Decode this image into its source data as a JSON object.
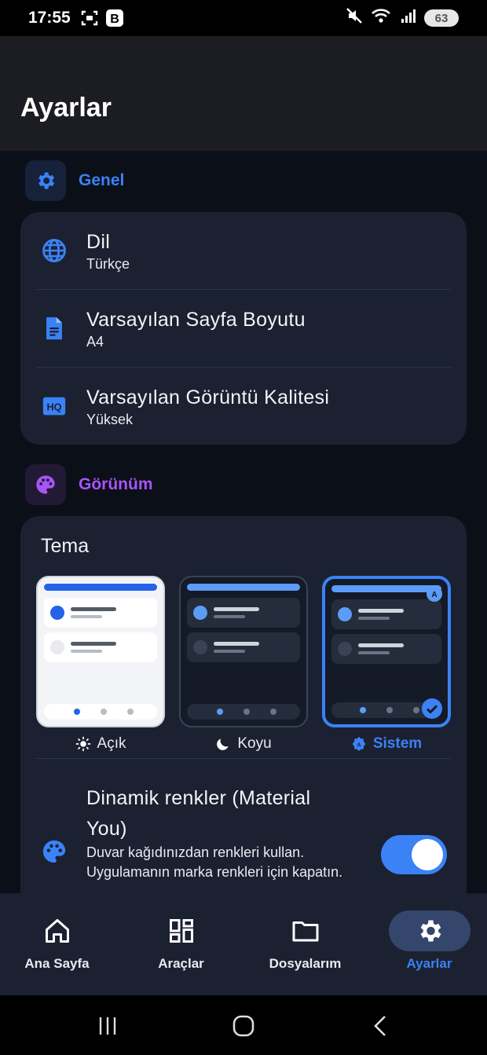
{
  "status_bar": {
    "time": "17:55",
    "battery": "63"
  },
  "header": {
    "title": "Ayarlar"
  },
  "sections": {
    "general": {
      "title": "Genel",
      "color": "#3b82f6",
      "items": [
        {
          "title": "Dil",
          "value": "Türkçe",
          "icon": "globe-icon"
        },
        {
          "title": "Varsayılan Sayfa Boyutu",
          "value": "A4",
          "icon": "document-icon"
        },
        {
          "title": "Varsayılan Görüntü Kalitesi",
          "value": "Yüksek",
          "icon": "hq-icon"
        }
      ]
    },
    "appearance": {
      "title": "Görünüm",
      "color": "#a855f7",
      "theme_label": "Tema",
      "themes": [
        {
          "name": "Açık",
          "icon": "sun-icon",
          "selected": false
        },
        {
          "name": "Koyu",
          "icon": "moon-icon",
          "selected": false
        },
        {
          "name": "Sistem",
          "icon": "auto-icon",
          "selected": true
        }
      ],
      "dynamic_colors": {
        "title": "Dinamik renkler (Material You)",
        "description": "Duvar kağıdınızdan renkleri kullan. Uygulamanın marka renkleri için kapatın.",
        "enabled": true
      }
    }
  },
  "bottom_nav": [
    {
      "label": "Ana Sayfa",
      "icon": "home-icon",
      "active": false
    },
    {
      "label": "Araçlar",
      "icon": "tools-icon",
      "active": false
    },
    {
      "label": "Dosyalarım",
      "icon": "folder-icon",
      "active": false
    },
    {
      "label": "Ayarlar",
      "icon": "gear-icon",
      "active": true
    }
  ],
  "colors": {
    "accent": "#3b82f6",
    "card": "#1b2130",
    "background": "#0b0f18"
  }
}
